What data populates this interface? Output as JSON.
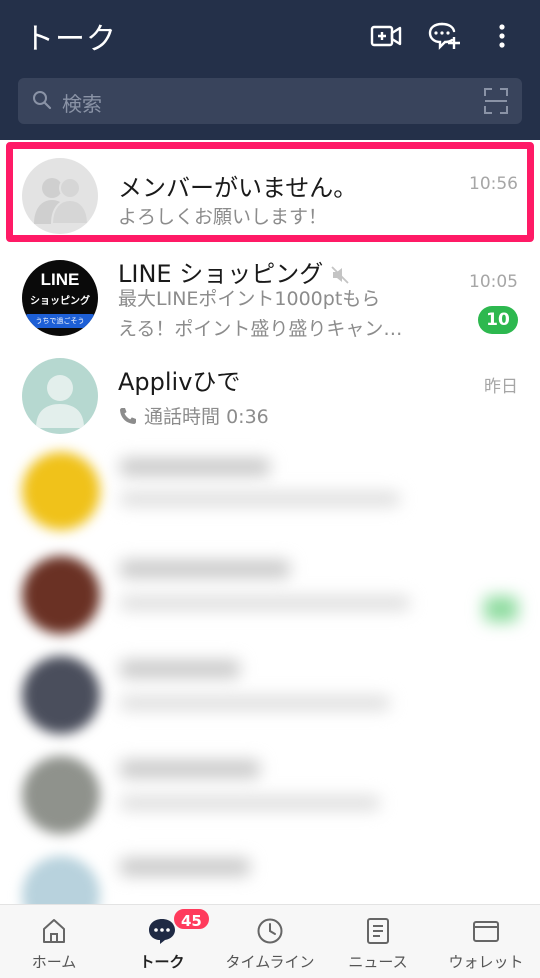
{
  "header": {
    "title": "トーク",
    "search_placeholder": "検索",
    "icons": [
      "video-call-icon",
      "new-chat-icon",
      "more-icon"
    ]
  },
  "chats": [
    {
      "name": "メンバーがいません。",
      "message": "よろしくお願いします！",
      "time": "10:56",
      "avatar": "group-placeholder"
    },
    {
      "name": "LINE ショッピング",
      "message_line1": "最大LINEポイント1000ptもら",
      "message_line2": "える！ポイント盛り盛りキャン…",
      "time": "10:05",
      "unread": "10",
      "muted": true,
      "avatar_text": {
        "line1": "LINE",
        "line2": "ショッピング",
        "line3": "うちで過ごそう"
      }
    },
    {
      "name": "Applivひで",
      "message": "通話時間 0:36",
      "time": "昨日",
      "avatar": "person-placeholder"
    }
  ],
  "tabs": [
    {
      "label": "ホーム",
      "icon": "home-icon"
    },
    {
      "label": "トーク",
      "icon": "chat-icon",
      "badge": "45",
      "active": true
    },
    {
      "label": "タイムライン",
      "icon": "clock-icon"
    },
    {
      "label": "ニュース",
      "icon": "news-icon"
    },
    {
      "label": "ウォレット",
      "icon": "wallet-icon"
    }
  ],
  "colors": {
    "header_bg": "#243049",
    "highlight": "#ff1a66",
    "unread_badge": "#2db84f",
    "tab_badge": "#ff3b5c"
  }
}
